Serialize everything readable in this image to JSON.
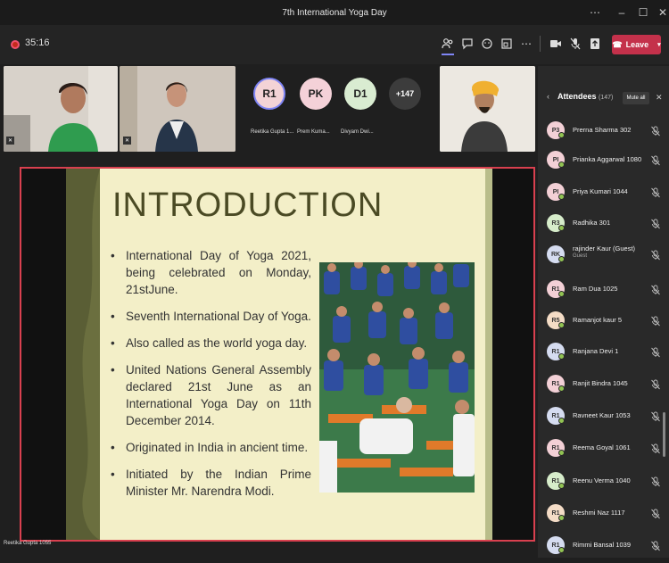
{
  "window": {
    "title": "7th International Yoga Day"
  },
  "toolbar": {
    "timer": "35:16",
    "leave_label": "Leave"
  },
  "participants": [
    {
      "initials": "R1",
      "name": "Reetika Gupta 1...",
      "color": "#f3d3d6"
    },
    {
      "initials": "PK",
      "name": "Prem Kuma...",
      "color": "#f4d1d8"
    },
    {
      "initials": "D1",
      "name": "Divyam Dwi...",
      "color": "#d9ecd1"
    }
  ],
  "overflow_count": "+147",
  "slide": {
    "title": "INTRODUCTION",
    "bullets": [
      "International Day of Yoga 2021, being celebrated on Monday, 21stJune.",
      "Seventh International Day of Yoga.",
      "Also called as the world yoga day.",
      "United Nations General Assembly declared 21st June as an International Yoga Day on 11th December 2014.",
      "Originated in India in ancient time.",
      "Initiated by the Indian Prime Minister Mr. Narendra Modi."
    ]
  },
  "presenter_label": "Reetika Gupta 1055",
  "panel": {
    "title": "Attendees",
    "count": "(147)",
    "mute_all": "Mute all"
  },
  "attendees": [
    {
      "initials": "P3",
      "name": "Prerna Sharma 302",
      "color": "#f3d0d6"
    },
    {
      "initials": "PI",
      "name": "Prianka Aggarwal 1080",
      "color": "#f3d0d6"
    },
    {
      "initials": "PI",
      "name": "Priya Kumari 1044",
      "color": "#f3d0d6"
    },
    {
      "initials": "R3",
      "name": "Radhika 301",
      "color": "#d6ecca"
    },
    {
      "initials": "RK",
      "name": "rajinder Kaur (Guest)",
      "sub": "Guest",
      "color": "#d5dcf0"
    },
    {
      "initials": "R1",
      "name": "Ram Dua 1025",
      "color": "#f3d0d6"
    },
    {
      "initials": "R5",
      "name": "Ramanjot kaur 5",
      "color": "#f4dcc6"
    },
    {
      "initials": "R1",
      "name": "Ranjana Devi 1",
      "color": "#d5dcf0"
    },
    {
      "initials": "R1",
      "name": "Ranjit Bindra 1045",
      "color": "#f3d0d6"
    },
    {
      "initials": "R1",
      "name": "Ravneet Kaur 1053",
      "color": "#d5dcf0"
    },
    {
      "initials": "R1",
      "name": "Reema Goyal 1061",
      "color": "#f3d0d6"
    },
    {
      "initials": "R1",
      "name": "Reenu Verma 1040",
      "color": "#d6ecca"
    },
    {
      "initials": "R1",
      "name": "Reshmi Naz 1117",
      "color": "#f4dcc6"
    },
    {
      "initials": "R1",
      "name": "Rimmi Bansal 1039",
      "color": "#d5dcf0"
    }
  ],
  "colors": {
    "leave": "#c4314b",
    "accent": "#d9404f",
    "slide_bg": "#f3efc8"
  }
}
